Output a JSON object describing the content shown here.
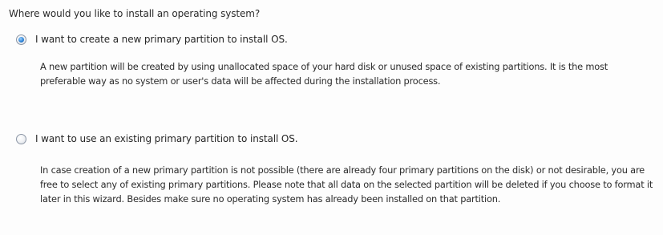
{
  "question": "Where would you like to install an operating system?",
  "options": [
    {
      "label": "I want to create a new primary partition to install OS.",
      "selected": true,
      "description": "A new partition will be created by using unallocated space of your hard disk or unused space of existing partitions. It is the most preferable way as no system or user's data will be affected during the installation process."
    },
    {
      "label": "I want to use an existing primary partition to install OS.",
      "selected": false,
      "description": "In case creation of a new primary partition is not possible (there are already four primary partitions on the disk) or not desirable, you are free to select any of existing primary partitions. Please note that all data on the selected partition will be deleted if you choose to format it later in this wizard. Besides make sure no operating system has already been installed on that partition."
    }
  ],
  "colors": {
    "radio_checked": "#2f84d6",
    "text": "#262626"
  }
}
